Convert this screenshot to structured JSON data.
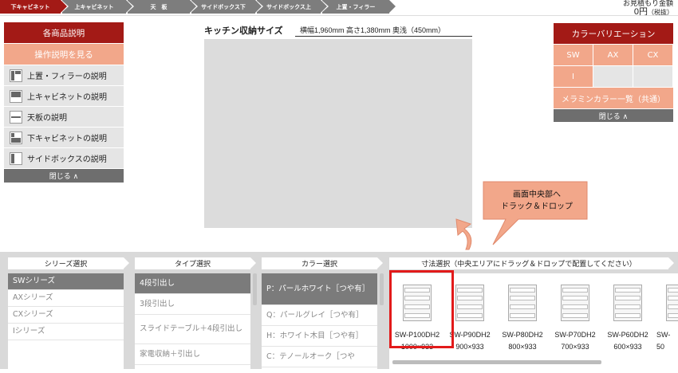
{
  "steps": [
    {
      "label": "下キャビネット",
      "active": true
    },
    {
      "label": "上キャビネット",
      "active": false
    },
    {
      "label": "天　板",
      "active": false
    },
    {
      "label": "サイドボックス下",
      "active": false
    },
    {
      "label": "サイドボックス上",
      "active": false
    },
    {
      "label": "上置・フィラー",
      "active": false
    }
  ],
  "estimate": {
    "label": "お見積もり金額",
    "amount": "0円",
    "tax": "（税抜）"
  },
  "left_panel": {
    "title": "各商品説明",
    "operation": "操作説明を見る",
    "items": [
      {
        "label": "上置・フィラーの説明",
        "icon": "top-filler-icon"
      },
      {
        "label": "上キャビネットの説明",
        "icon": "upper-cabinet-icon"
      },
      {
        "label": "天板の説明",
        "icon": "countertop-icon"
      },
      {
        "label": "下キャビネットの説明",
        "icon": "lower-cabinet-icon"
      },
      {
        "label": "サイドボックスの説明",
        "icon": "side-box-icon"
      }
    ],
    "close": "閉じる ∧"
  },
  "center": {
    "title": "キッチン収納サイズ",
    "dims": "横幅1,960mm  高さ1,380mm  奥浅（450mm）"
  },
  "right_panel": {
    "title": "カラーバリエーション",
    "colors": [
      "SW",
      "AX",
      "CX",
      "I",
      "",
      ""
    ],
    "melamine": "メラミンカラー一覧（共通）",
    "close": "閉じる ∧"
  },
  "callout": {
    "line1": "画面中央部へ",
    "line2": "ドラック＆ドロップ"
  },
  "bottom": {
    "series": {
      "header": "シリーズ選択",
      "options": [
        "SWシリーズ",
        "AXシリーズ",
        "CXシリーズ",
        "Iシリーズ"
      ],
      "selected": 0
    },
    "type": {
      "header": "タイプ選択",
      "options": [
        "4段引出し",
        "3段引出し",
        "スライドテーブル＋4段引出し",
        "家電収納＋引出し"
      ],
      "selected": 0
    },
    "color": {
      "header": "カラー選択",
      "options": [
        "P：パールホワイト［つや有］",
        "Q：パールグレイ［つや有］",
        "H：ホワイト木目［つや有］",
        "C：テノールオーク［つや"
      ],
      "selected": 0
    },
    "size": {
      "header": "寸法選択（中央エリアにドラッグ＆ドロップで配置してください）",
      "items": [
        {
          "code": "SW-P100DH2",
          "dim": "1000×933"
        },
        {
          "code": "SW-P90DH2",
          "dim": "900×933"
        },
        {
          "code": "SW-P80DH2",
          "dim": "800×933"
        },
        {
          "code": "SW-P70DH2",
          "dim": "700×933"
        },
        {
          "code": "SW-P60DH2",
          "dim": "600×933"
        },
        {
          "code": "SW-",
          "dim": "50"
        }
      ],
      "selected": 0
    }
  },
  "colors": {
    "accent": "#a31a16",
    "salmon": "#f2a78a",
    "selected_border": "#e21a1a"
  }
}
